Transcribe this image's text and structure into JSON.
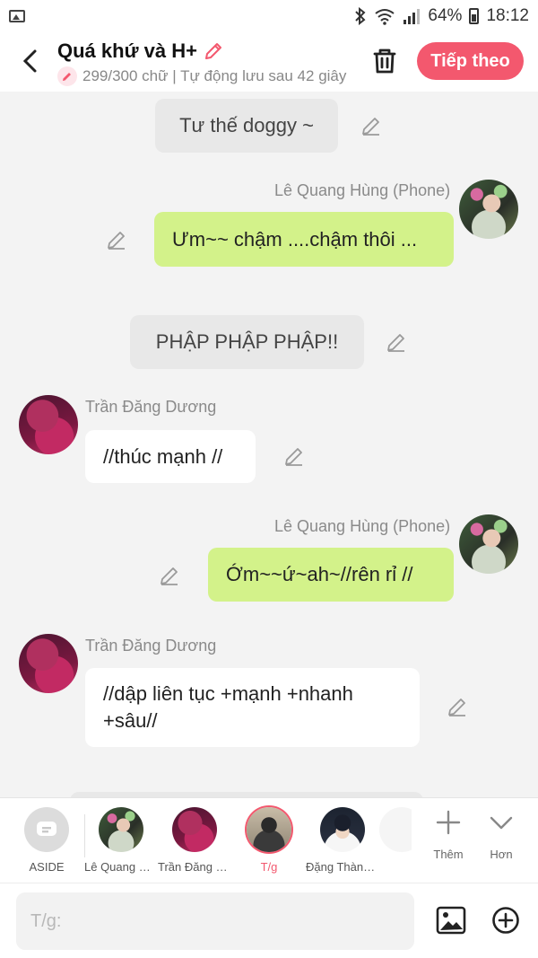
{
  "status_bar": {
    "battery": "64%",
    "time": "18:12"
  },
  "header": {
    "title": "Quá khứ và H+",
    "subtitle": "299/300 chữ | Tự động lưu sau 42 giây",
    "next_label": "Tiếp theo"
  },
  "messages": [
    {
      "type": "narration",
      "text": "Tư thế doggy ~"
    },
    {
      "type": "me",
      "name": "Lê Quang Hùng (Phone)",
      "text": "Ưm~~ chậm ....chậm thôi ..."
    },
    {
      "type": "narration",
      "text": "PHẬP PHẬP PHẬP!!"
    },
    {
      "type": "other",
      "name": "Trần Đăng Dương",
      "text": "//thúc mạnh //"
    },
    {
      "type": "me",
      "name": "Lê Quang Hùng (Phone)",
      "text": "Ớm~~ứ~ah~//rên rỉ //"
    },
    {
      "type": "other",
      "name": "Trần Đăng Dương",
      "text": "//dập liên tục +mạnh +nhanh +sâu//"
    }
  ],
  "characters": [
    {
      "label": "ASIDE"
    },
    {
      "label": "Lê Quang Hùng"
    },
    {
      "label": "Trần Đăng Dương"
    },
    {
      "label": "T/g"
    },
    {
      "label": "Đặng Thành An"
    }
  ],
  "tools": {
    "add_label": "Thêm",
    "more_label": "Hơn"
  },
  "input": {
    "placeholder": "T/g:"
  },
  "colors": {
    "accent": "#f3586e",
    "my_bubble": "#d3f28a",
    "narration_bubble": "#e8e8e8"
  }
}
